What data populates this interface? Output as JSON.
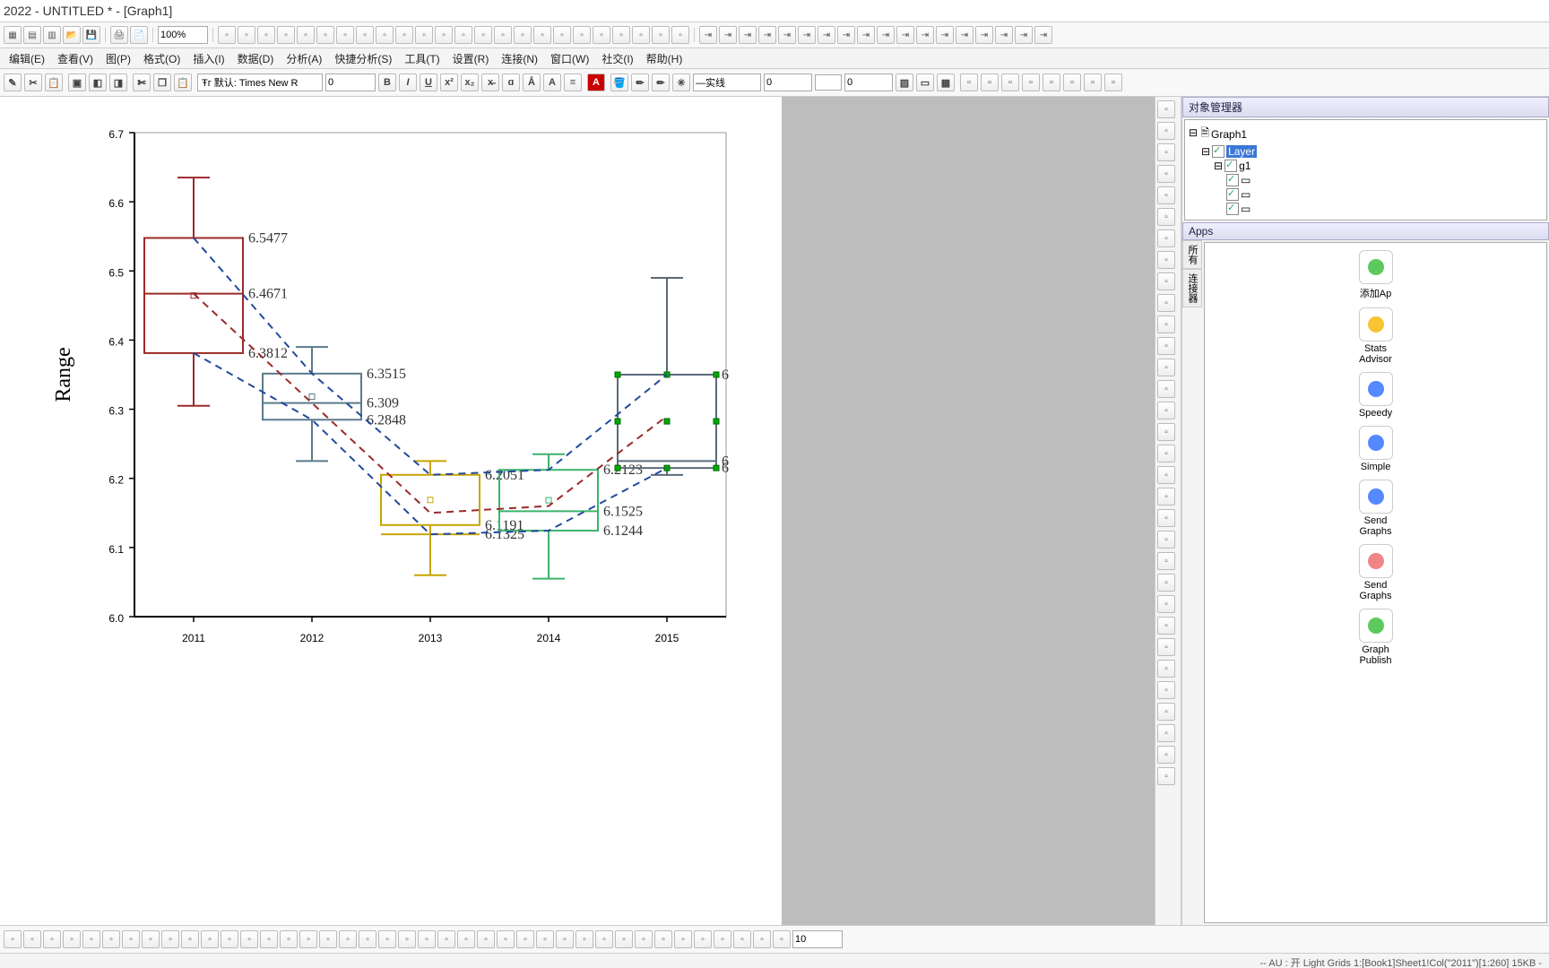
{
  "window": {
    "title": " 2022 - UNTITLED * - [Graph1]"
  },
  "zoom": "100%",
  "menus": [
    "编辑(E)",
    "查看(V)",
    "图(P)",
    "格式(O)",
    "插入(I)",
    "数据(D)",
    "分析(A)",
    "快捷分析(S)",
    "工具(T)",
    "设置(R)",
    "连接(N)",
    "窗口(W)",
    "社交(I)",
    "帮助(H)"
  ],
  "font": {
    "prefix": "默认: Times New R",
    "size": "0"
  },
  "line": {
    "style": "—实线",
    "width": "0"
  },
  "fill": {
    "val": "0"
  },
  "object_mgr": {
    "title": "对象管理器",
    "root": "Graph1",
    "layer": "Layer",
    "g1": "g1"
  },
  "apps_hdr": "Apps",
  "apps_vtabs": [
    "所有",
    "连接器"
  ],
  "apps": [
    {
      "name": "添加Ap",
      "color": "#3b3"
    },
    {
      "name": "Stats Advisor",
      "color": "#f7b500"
    },
    {
      "name": "Speedy",
      "color": "#2b6cff"
    },
    {
      "name": "Simple",
      "color": "#2b6cff"
    },
    {
      "name": "Send Graphs",
      "color": "#2b6cff"
    },
    {
      "name": "Send Graphs ",
      "color": "#e66"
    },
    {
      "name": "Graph Publish",
      "color": "#3b3"
    }
  ],
  "bottom_num": "10",
  "status": "--   AU : 开  Light Grids  1:[Book1]Sheet1!Col(\"2011\")[1:260]  15KB -",
  "chart_data": {
    "type": "boxplot",
    "ylabel": "Range",
    "ylim": [
      6.0,
      6.7
    ],
    "yticks": [
      6.0,
      6.1,
      6.2,
      6.3,
      6.4,
      6.5,
      6.6,
      6.7
    ],
    "categories": [
      "2011",
      "2012",
      "2013",
      "2014",
      "2015"
    ],
    "boxes": [
      {
        "cat": "2011",
        "color": "#9c2a2a",
        "q1": 6.3812,
        "med": 6.4671,
        "q3": 6.5477,
        "low": 6.305,
        "high": 6.635,
        "labels": [
          "6.5477",
          "6.4671",
          "6.3812"
        ]
      },
      {
        "cat": "2012",
        "color": "#5a7a8c",
        "q1": 6.2848,
        "med": 6.309,
        "q3": 6.3515,
        "low": 6.225,
        "high": 6.39,
        "labels": [
          "6.3515",
          "6.309",
          "6.2848"
        ]
      },
      {
        "cat": "2013",
        "color": "#c8a400",
        "q1": 6.1325,
        "med": 6.1191,
        "q3": 6.2051,
        "low": 6.06,
        "high": 6.225,
        "labels": [
          "6.2051",
          "6.1325",
          "6.1191"
        ]
      },
      {
        "cat": "2014",
        "color": "#3bb36b",
        "q1": 6.1244,
        "med": 6.1525,
        "q3": 6.2123,
        "low": 6.055,
        "high": 6.235,
        "labels": [
          "6.2123",
          "6.1525",
          "6.1244"
        ]
      },
      {
        "cat": "2015",
        "color": "#5a6a7a",
        "q1": 6.215,
        "med": 6.225,
        "q3": 6.35,
        "low": 6.205,
        "high": 6.49,
        "labels": [
          "6",
          "6",
          "6"
        ]
      }
    ],
    "trend_red": [
      6.4671,
      6.309,
      6.15,
      6.16,
      6.29
    ],
    "trend_blue_top": [
      6.5477,
      6.3515,
      6.2051,
      6.2123,
      6.35
    ],
    "trend_blue_bot": [
      6.3812,
      6.2848,
      6.119,
      6.1244,
      6.215
    ]
  }
}
